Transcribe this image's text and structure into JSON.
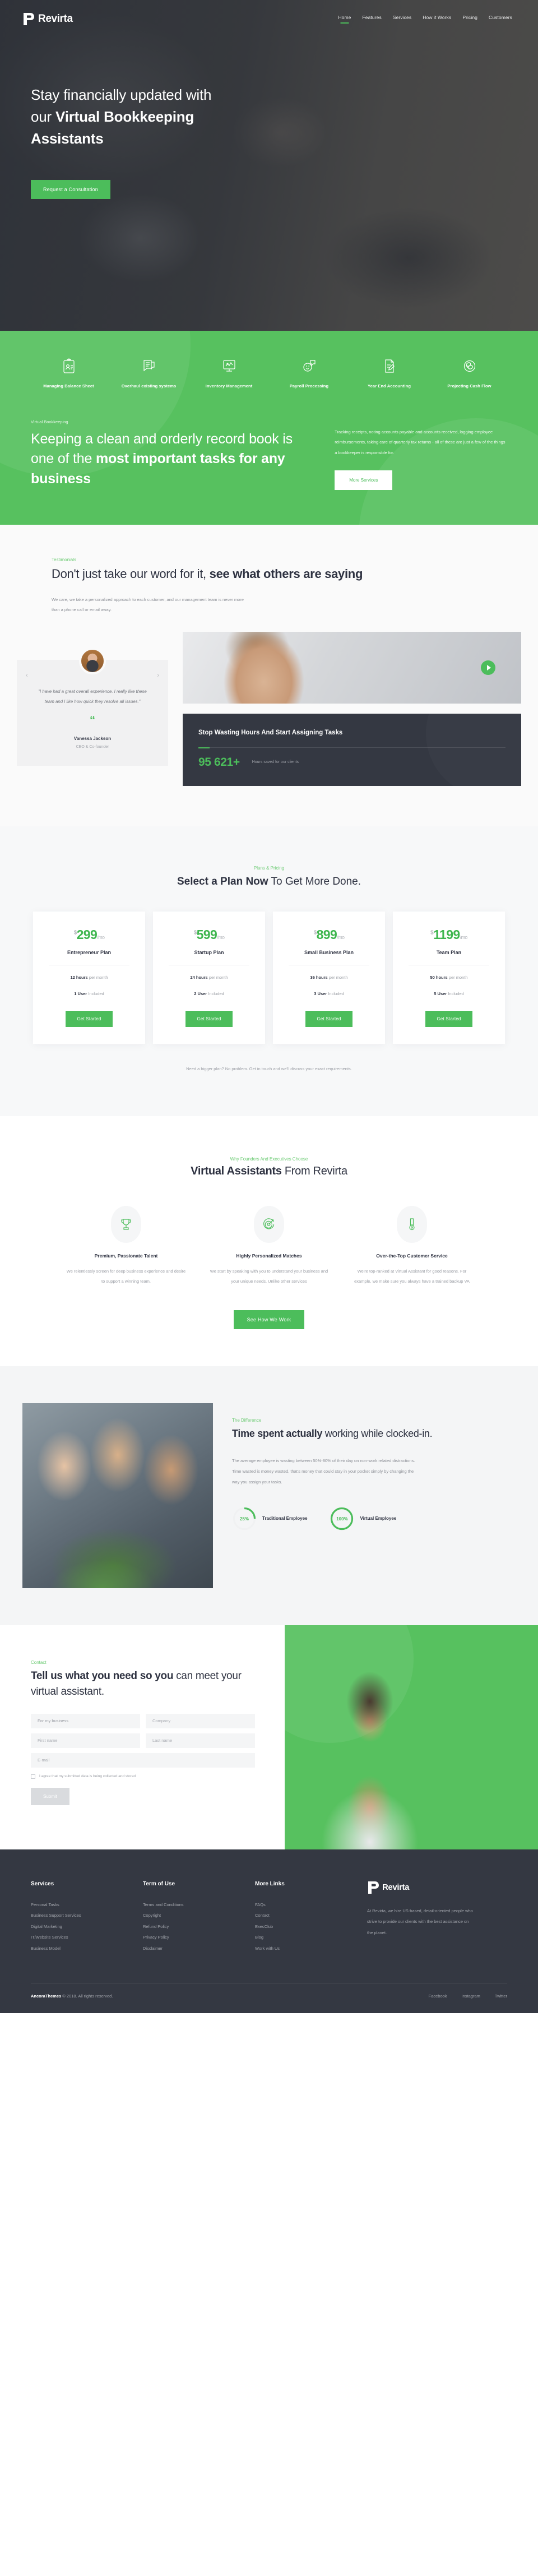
{
  "brand": {
    "name": "Revirta"
  },
  "nav": {
    "items": [
      {
        "label": "Home",
        "active": true
      },
      {
        "label": "Features",
        "active": false
      },
      {
        "label": "Services",
        "active": false
      },
      {
        "label": "How it Works",
        "active": false
      },
      {
        "label": "Pricing",
        "active": false
      },
      {
        "label": "Customers",
        "active": false
      }
    ]
  },
  "hero": {
    "title_line1": "Stay financially updated with",
    "title_line2_plain": "our ",
    "title_line2_bold": "Virtual Bookkeeping",
    "title_line3_bold": "Assistants",
    "cta": "Request a Consultation"
  },
  "services": {
    "items": [
      {
        "label": "Managing Balance Sheet",
        "icon": "clipboard-person-icon"
      },
      {
        "label": "Overhaul existing systems",
        "icon": "chat-document-icon"
      },
      {
        "label": "Inventory Management",
        "icon": "monitor-chart-icon"
      },
      {
        "label": "Payroll Processing",
        "icon": "smiley-chat-icon"
      },
      {
        "label": "Year End Accounting",
        "icon": "document-pen-icon"
      },
      {
        "label": "Projecting Cash Flow",
        "icon": "coins-circle-icon"
      }
    ],
    "eyebrow": "Virtual Bookkeeping",
    "heading_plain": "Keeping a clean and orderly record book is one of the ",
    "heading_bold": "most important tasks for any business",
    "paragraph": "Tracking receipts, noting accounts payable and accounts received, logging employee reimbursements, taking care of quarterly tax returns - all of these are just a few of the things a bookkeeper is responsible for.",
    "cta": "More Services"
  },
  "testimonials": {
    "eyebrow": "Testimonials",
    "heading_plain": "Don't just take our word for it, ",
    "heading_bold": "see what others are saying",
    "subtext": "We care, we take a personalized approach to each customer, and our management team is never more than a phone call or email away.",
    "quote": "\"I have had a great overall experience. I really like these team and I like how quick they resolve all issues.\"",
    "quote_mark": "“",
    "author": "Vanessa Jackson",
    "role": "CEO & Co-founder",
    "prev_arrow": "‹",
    "next_arrow": "›",
    "stat_card": {
      "heading": "Stop Wasting Hours And Start Assigning Tasks",
      "number": "95 621+",
      "label": "Hours saved for our clients"
    }
  },
  "pricing": {
    "eyebrow": "Plans & Pricing",
    "heading_bold": "Select a Plan Now",
    "heading_plain": " To Get More Done.",
    "currency": "$",
    "per": "/mo",
    "plans": [
      {
        "price": "299",
        "name": "Entrepreneur Plan",
        "hours": "12 hours",
        "hours_suffix": " per month",
        "users": "1 User",
        "users_suffix": " Included",
        "cta": "Get Started"
      },
      {
        "price": "599",
        "name": "Startup Plan",
        "hours": "24 hours",
        "hours_suffix": " per month",
        "users": "2 User",
        "users_suffix": " Included",
        "cta": "Get Started"
      },
      {
        "price": "899",
        "name": "Small Business Plan",
        "hours": "36 hours",
        "hours_suffix": " per month",
        "users": "3 User",
        "users_suffix": " Included",
        "cta": "Get Started"
      },
      {
        "price": "1199",
        "name": "Team Plan",
        "hours": "50 hours",
        "hours_suffix": " per month",
        "users": "5 User",
        "users_suffix": " Included",
        "cta": "Get Started"
      }
    ],
    "note": "Need a bigger plan? No problem. Get in touch and we'll discuss your exact requirements."
  },
  "why": {
    "eyebrow": "Why Founders And Executives Choose",
    "heading_bold": "Virtual Assistants",
    "heading_plain": " From Revirta",
    "columns": [
      {
        "icon": "trophy-icon",
        "title": "Premium, Passionate Talent",
        "text": "We relentlessly screen for deep business experience and desire to support a winning team."
      },
      {
        "icon": "target-icon",
        "title": "Highly Personalized Matches",
        "text": "We start by speaking with you to understand your business and your unique needs. Unlike other services"
      },
      {
        "icon": "medal-icon",
        "title": "Over-the-Top Customer Service",
        "text": "We're top-ranked at Virtual Assistant for good reasons. For example, we make sure you always have a trained backup VA"
      }
    ],
    "cta": "See How We Work"
  },
  "difference": {
    "eyebrow": "The Difference",
    "heading_bold": "Time spent actually",
    "heading_plain": " working while clocked-in.",
    "paragraph": "The average employee is wasting between 50%-80% of their day on non-work related distractions. Time wasted is money wasted, that's money that could stay in your pocket simply by changing the way you assign your tasks.",
    "accent": "#4cbd5b"
  },
  "chart_data": {
    "type": "pie",
    "title": "Time spent actually working while clocked-in",
    "categories": [
      "Traditional Employee",
      "Virtual Employee"
    ],
    "values": [
      25,
      100
    ],
    "value_labels": [
      "25%",
      "100%"
    ],
    "unit": "%",
    "ylim": [
      0,
      100
    ],
    "legend_position": "right-of-each-donut",
    "grid": false,
    "series": [
      {
        "name": "Traditional Employee",
        "value": 25,
        "label": "25%",
        "color": "#4cbd5b",
        "track_color": "#f0f1f2"
      },
      {
        "name": "Virtual Employee",
        "value": 100,
        "label": "100%",
        "color": "#4cbd5b",
        "track_color": "#f0f1f2"
      }
    ]
  },
  "contact": {
    "eyebrow": "Contact",
    "heading_bold_1": "Tell us what you need so you",
    "heading_plain": " can meet your virtual assistant.",
    "fields": {
      "type": "For my business",
      "type_caret": "⌄",
      "company_placeholder": "Company",
      "first_name_placeholder": "First name",
      "last_name_placeholder": "Last name",
      "email_placeholder": "E-mail"
    },
    "consent": "I agree that my submitted data is being collected and stored",
    "submit": "Submit"
  },
  "footer": {
    "columns": [
      {
        "title": "Services",
        "links": [
          "Personal Tasks",
          "Business Support Services",
          "Digital Marketing",
          "IT/Website Services",
          "Business Model"
        ]
      },
      {
        "title": "Term of Use",
        "links": [
          "Terms and Conditions",
          "Copyright",
          "Refund Policy",
          "Privacy Policy",
          "Disclaimer"
        ]
      },
      {
        "title": "More Links",
        "links": [
          "FAQs",
          "Contact",
          "ExecClub",
          "Blog",
          "Work with Us"
        ]
      }
    ],
    "about": "At Revirta, we hire US-based, detail-oriented people who strive to provide our clients with the best assistance on the planet.",
    "copyright_brand": "AncoraThemes",
    "copyright_rest": " © 2018. All rights reserved.",
    "socials": [
      "Facebook",
      "Instagram",
      "Twitter"
    ]
  }
}
